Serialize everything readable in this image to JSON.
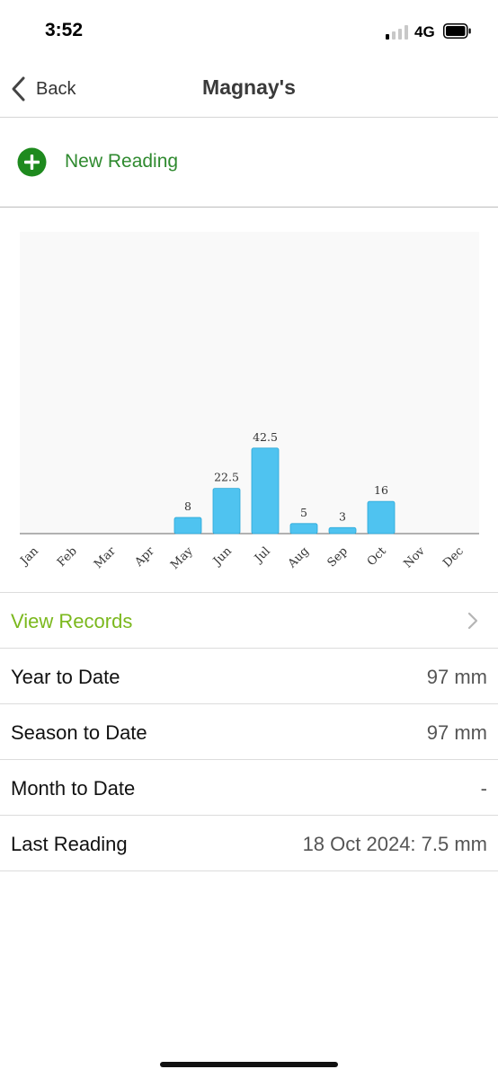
{
  "status_bar": {
    "time": "3:52",
    "network": "4G",
    "signal_bars_active": 1,
    "signal_bars_total": 4
  },
  "nav": {
    "back_label": "Back",
    "title": "Magnay's"
  },
  "actions": {
    "new_reading_label": "New Reading"
  },
  "chart_data": {
    "type": "bar",
    "categories": [
      "Jan",
      "Feb",
      "Mar",
      "Apr",
      "May",
      "Jun",
      "Jul",
      "Aug",
      "Sep",
      "Oct",
      "Nov",
      "Dec"
    ],
    "values": [
      null,
      null,
      null,
      null,
      8,
      22.5,
      42.5,
      5,
      3,
      16,
      null,
      null
    ],
    "value_labels": [
      "",
      "",
      "",
      "",
      "8",
      "22.5",
      "42.5",
      "5",
      "3",
      "16",
      "",
      ""
    ],
    "ylim": [
      0,
      150
    ],
    "bar_color": "#4fc3f0",
    "background_color": "#f9f9f9",
    "grid": false,
    "legend": "none"
  },
  "records": {
    "view_records_label": "View Records",
    "rows": [
      {
        "label": "Year to Date",
        "value": "97 mm"
      },
      {
        "label": "Season to Date",
        "value": "97 mm"
      },
      {
        "label": "Month to Date",
        "value": "-"
      },
      {
        "label": "Last Reading",
        "value": "18 Oct 2024: 7.5 mm"
      }
    ]
  },
  "colors": {
    "accent_green": "#2f8a2f",
    "view_records_green": "#7bb81d",
    "plus_icon_green": "#1e8a1e",
    "bar_blue": "#4fc3f0"
  }
}
